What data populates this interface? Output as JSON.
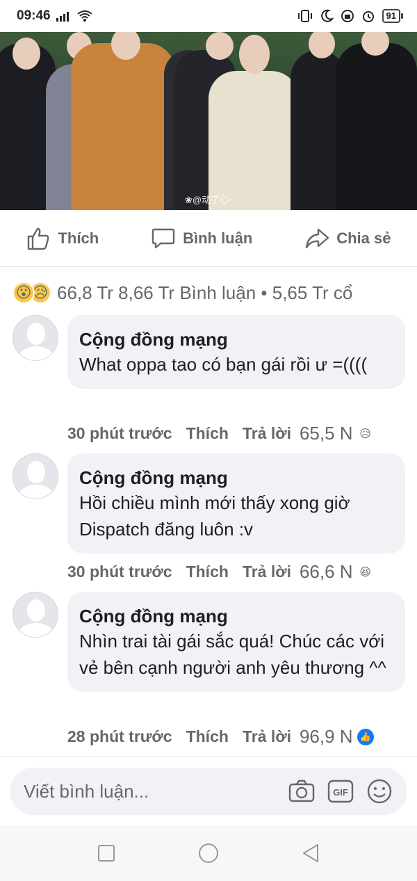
{
  "status_bar": {
    "time": "09:46",
    "battery": "91"
  },
  "photo": {
    "watermark": "❀@动了心~"
  },
  "actions": {
    "like": "Thích",
    "comment": "Bình luận",
    "share": "Chia sẻ"
  },
  "summary": {
    "text": "66,8 Tr 8,66 Tr  Bình luận • 5,65 Tr  cổ"
  },
  "comments": [
    {
      "author": "Cộng đồng mạng",
      "text": "What oppa tao có bạn gái rồi ư =((((",
      "time": "30 phút trước",
      "like": "Thích",
      "reply": "Trả lời",
      "count": "65,5 N",
      "reaction": "😥"
    },
    {
      "author": "Cộng đồng mạng",
      "text": "Hồi chiều mình mới thấy xong giờ Dispatch đăng luôn :v",
      "time": "30 phút trước",
      "like": "Thích",
      "reply": "Trả lời",
      "count": "66,6 N",
      "reaction": "😆"
    },
    {
      "author": "Cộng đồng mạng",
      "text": "Nhìn trai tài gái sắc quá! Chúc các với vẻ bên cạnh người anh yêu thương ^^",
      "time": "28 phút trước",
      "like": "Thích",
      "reply": "Trả lời",
      "count": "96,9 N",
      "reaction": "👍"
    }
  ],
  "composer": {
    "placeholder": "Viết bình luận..."
  },
  "colors": {
    "muted": "#65676b",
    "bubble": "#f0f2f5",
    "like_blue": "#1877f2"
  }
}
